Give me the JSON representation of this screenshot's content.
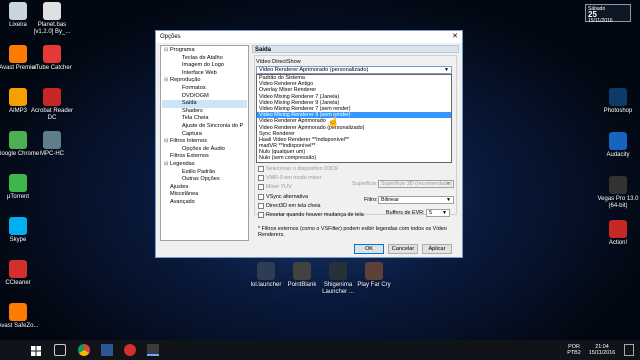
{
  "desktop": {
    "left_icons": [
      {
        "label": "Lixeira",
        "icon": "recycle-bin-icon",
        "color": "#c8d4e0"
      },
      {
        "label": "Avast Premier",
        "icon": "avast-icon",
        "color": "#ff7a00"
      },
      {
        "label": "AIMP3",
        "icon": "aimp-icon",
        "color": "#f5a000"
      },
      {
        "label": "Google Chrome",
        "icon": "chrome-icon",
        "color": "#4caf50"
      },
      {
        "label": "µTorrent",
        "icon": "utorrent-icon",
        "color": "#3db54a"
      },
      {
        "label": "Skype",
        "icon": "skype-icon",
        "color": "#00aff0"
      },
      {
        "label": "CCleaner",
        "icon": "ccleaner-icon",
        "color": "#d32f2f"
      },
      {
        "label": "Avast SafeZo...",
        "icon": "avast-safezone-icon",
        "color": "#ff7a00"
      }
    ],
    "second_col_icons": [
      {
        "label": "Planet.bas [v1.2.0] By_...",
        "icon": "file-icon",
        "color": "#e0e0e0"
      },
      {
        "label": "aTube Catcher",
        "icon": "atube-icon",
        "color": "#e53935"
      },
      {
        "label": "Acrobat Reader DC",
        "icon": "acrobat-icon",
        "color": "#c62828"
      },
      {
        "label": "MPC-HC",
        "icon": "mpc-icon",
        "color": "#607d8b"
      }
    ],
    "right_icons": [
      {
        "label": "Photoshop",
        "icon": "photoshop-icon",
        "color": "#0d3a66"
      },
      {
        "label": "Audacity",
        "icon": "audacity-icon",
        "color": "#1565c0"
      },
      {
        "label": "Vegas Pro 13.0 (64-bit)",
        "icon": "vegas-icon",
        "color": "#333333"
      },
      {
        "label": "Action!",
        "icon": "action-icon",
        "color": "#c62828"
      }
    ],
    "bottom_icons": [
      {
        "label": "lol.launcher",
        "icon": "lol-icon",
        "color": "#2c3e50"
      },
      {
        "label": "PointBlank",
        "icon": "pointblank-icon",
        "color": "#424242"
      },
      {
        "label": "Shigenima Launcher ...",
        "icon": "launcher-icon",
        "color": "#263238"
      },
      {
        "label": "Play Far Cry",
        "icon": "farcry-icon",
        "color": "#5d4037"
      }
    ]
  },
  "dialog": {
    "title": "Opções",
    "close": "✕",
    "tree": [
      {
        "label": "Programa",
        "level": 0,
        "exp": "⊟"
      },
      {
        "label": "Teclas de Atalho",
        "level": 1
      },
      {
        "label": "Imagem do Logo",
        "level": 1
      },
      {
        "label": "Interface Web",
        "level": 1
      },
      {
        "label": "Reprodução",
        "level": 0,
        "exp": "⊟"
      },
      {
        "label": "Formatos",
        "level": 1
      },
      {
        "label": "DVD/OGM",
        "level": 1
      },
      {
        "label": "Saída",
        "level": 1,
        "selected": true
      },
      {
        "label": "Shaders",
        "level": 1
      },
      {
        "label": "Tela Cheia",
        "level": 1
      },
      {
        "label": "Ajuste de Sincronia do P",
        "level": 1
      },
      {
        "label": "Captura",
        "level": 1
      },
      {
        "label": "Filtros Internos",
        "level": 0,
        "exp": "⊟"
      },
      {
        "label": "Opções de Áudio",
        "level": 1
      },
      {
        "label": "Filtros Externos",
        "level": 0
      },
      {
        "label": "Legendas",
        "level": 0,
        "exp": "⊟"
      },
      {
        "label": "Estilo Padrão",
        "level": 1
      },
      {
        "label": "Outras Opções",
        "level": 1
      },
      {
        "label": "Ajustes",
        "level": 0
      },
      {
        "label": "Miscelânea",
        "level": 0
      },
      {
        "label": "Avançado",
        "level": 0
      }
    ],
    "panel": {
      "heading": "Saída",
      "group_label": "Vídeo DirectShow",
      "selected_renderer": "Video Renderer Aprimorado (personalizado)",
      "dropdown_options": [
        "Padrão do Sistema",
        "Video Renderer Antigo",
        "Overlay Mixer Renderer",
        "Video Mixing Renderer 7 (Janela)",
        "Video Mixing Renderer 9 (Janela)",
        "Video Mixing Renderer 7 (sem render)",
        "Video Mixing Renderer 9 (sem render)",
        "Video Renderer Aprimorado",
        "Video Renderer Aprimorado (personalizado)",
        "Sync Renderer",
        "Haali Video Renderer **Indisponível**",
        "madVR **Indisponível**",
        "Nulo (qualquer um)",
        "Nulo (sem compressão)"
      ],
      "highlighted_index": 6,
      "checkboxes": [
        {
          "label": "Selecionar o dispositivo D3D9",
          "disabled": true
        },
        {
          "label": "VMR-9 em modo mixer",
          "disabled": true
        },
        {
          "label": "Mixer YUV",
          "disabled": true
        },
        {
          "label": "VSync alternativa",
          "disabled": false
        },
        {
          "label": "Direct3D em tela cheia",
          "disabled": false
        },
        {
          "label": "Resetar quando houver mudança de tela",
          "disabled": false
        }
      ],
      "surface_label": "Superfície:",
      "surface_value": "Superfície 3D (recomendado)",
      "filter_label": "Filtro:",
      "filter_value": "Bilinear",
      "evr_label": "Buffers de EVR:",
      "evr_value": "5",
      "note": "* Filtros externos (como o VSFilter) podem exibir legendas com todos os Vídeo Renderers."
    },
    "buttons": {
      "ok": "OK",
      "cancel": "Cancelar",
      "apply": "Aplicar"
    }
  },
  "clock_widget": {
    "line1": "Sábado",
    "line2": "25",
    "line3": "15/11/2016"
  },
  "taskbar": {
    "lang1": "POR",
    "lang2": "PTB2",
    "time": "21:04",
    "date": "15/11/2016"
  }
}
